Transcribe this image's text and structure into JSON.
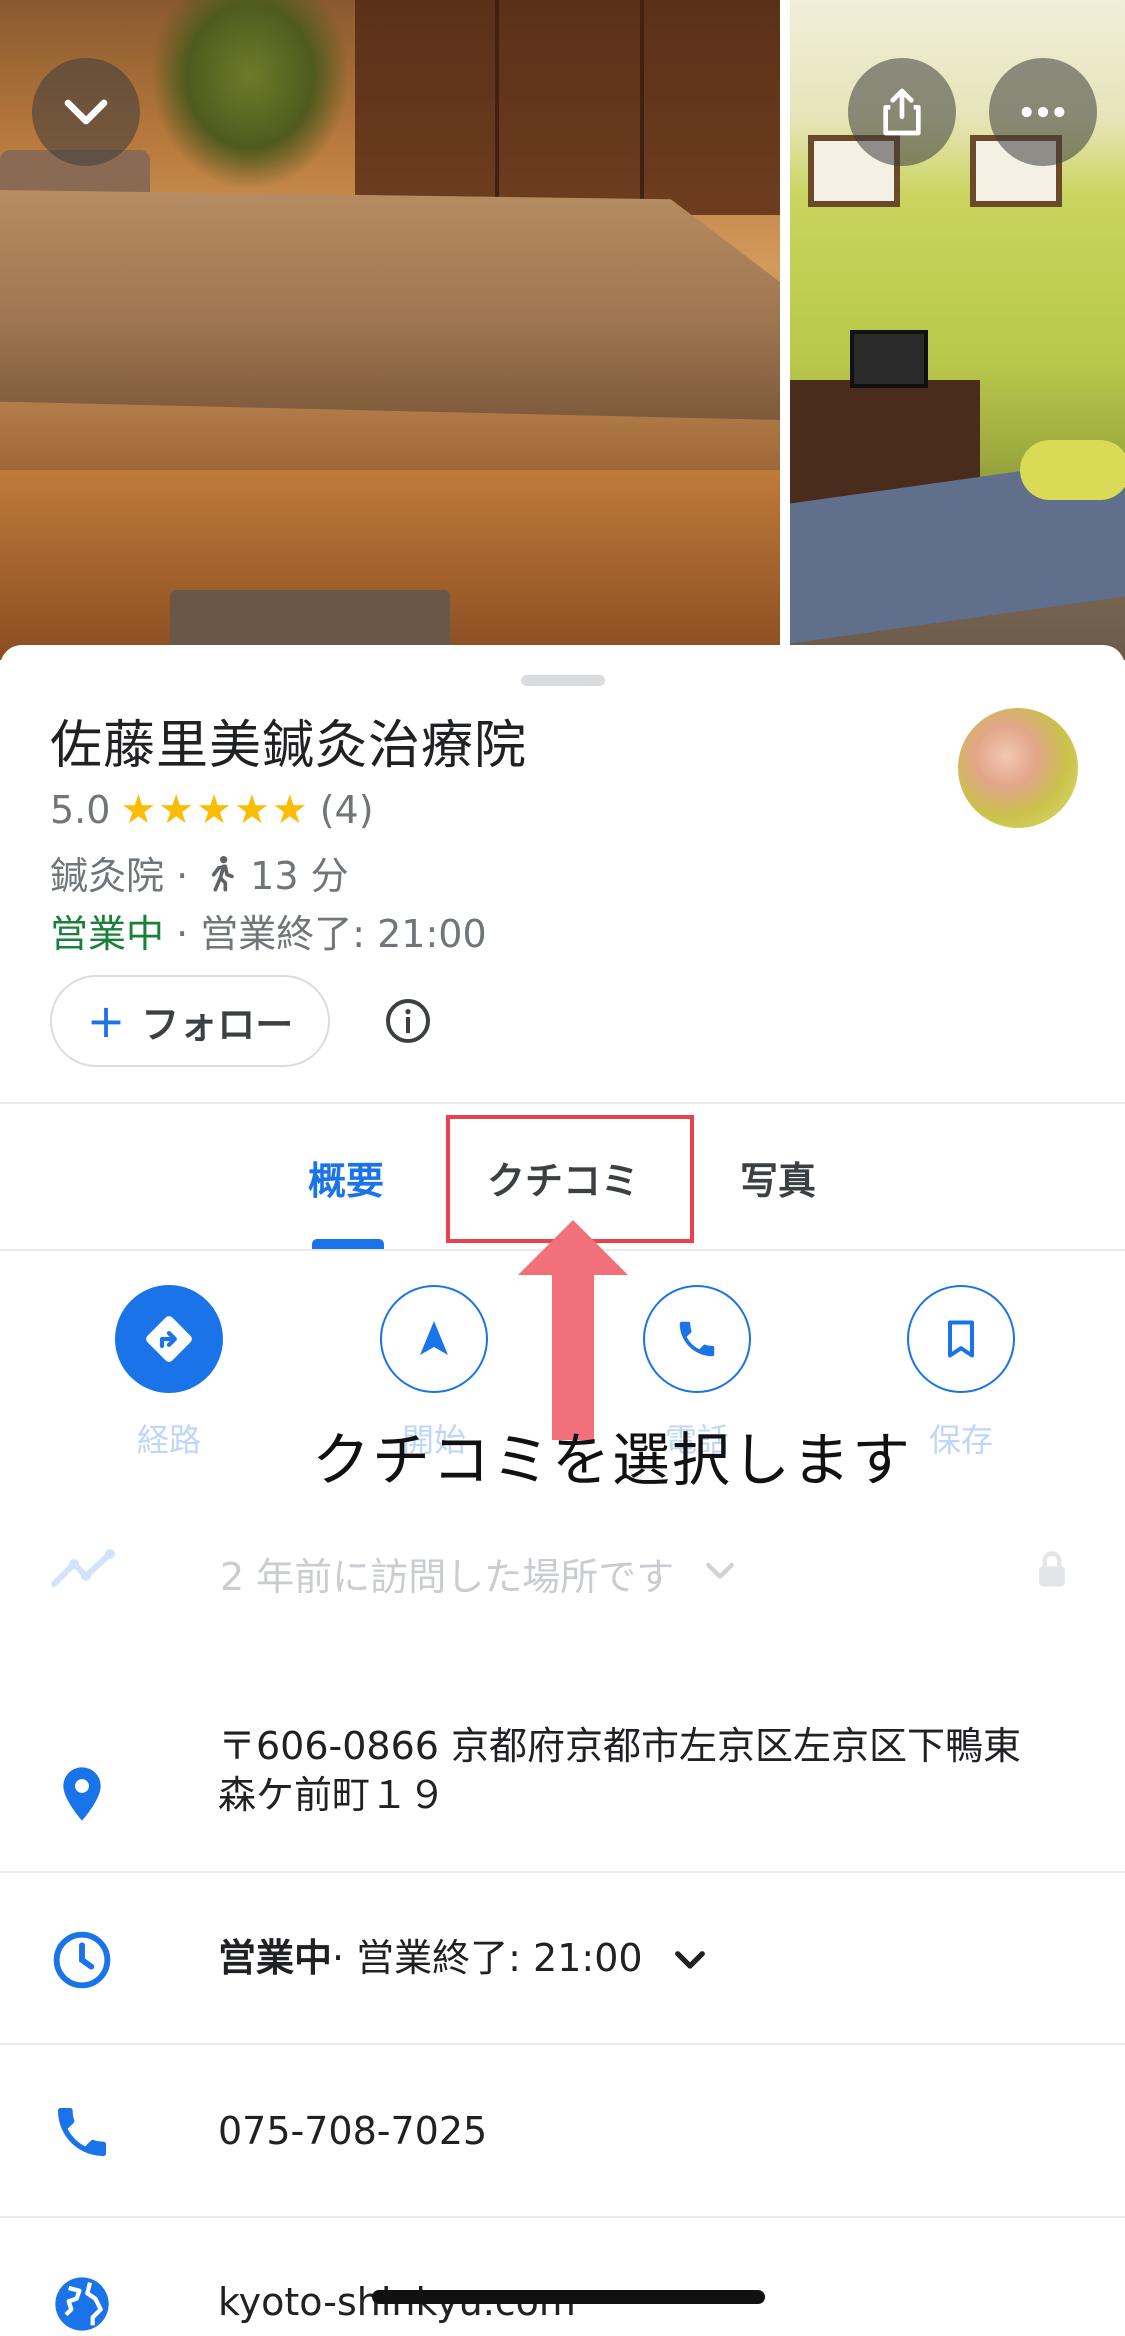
{
  "place": {
    "name": "佐藤里美鍼灸治療院",
    "rating": "5.0",
    "stars": "★★★★★",
    "review_count": "(4)",
    "category": "鍼灸院 ·",
    "walk_time": "13 分",
    "open_status": "営業中",
    "closing": " · 営業終了: 21:00"
  },
  "follow_label": "フォロー",
  "tabs": [
    "概要",
    "クチコミ",
    "写真"
  ],
  "actions": [
    "経路",
    "開始",
    "電話",
    "保存"
  ],
  "overlay_annotation": "クチコミを選択します",
  "visited_text": "2 年前に訪問した場所です",
  "details": {
    "address_line1": "〒606-0866 京都府京都市左京区左京区下鴨東",
    "address_line2": "森ケ前町１９",
    "hours_status": "営業中",
    "hours_closing": " · 営業終了: 21:00",
    "phone": "075-708-7025",
    "website": "kyoto-shinkyu.com"
  },
  "colors": {
    "accent_blue": "#1a73e8",
    "open_green": "#188038",
    "star_yellow": "#fbbc04",
    "annotation_red": "#e8424e"
  },
  "icons": [
    "chevron-down-icon",
    "share-icon",
    "more-icon",
    "walking-icon",
    "info-icon",
    "directions-icon",
    "navigation-icon",
    "phone-icon",
    "bookmark-icon",
    "trend-icon",
    "lock-icon",
    "location-pin-icon",
    "clock-icon",
    "globe-icon"
  ]
}
